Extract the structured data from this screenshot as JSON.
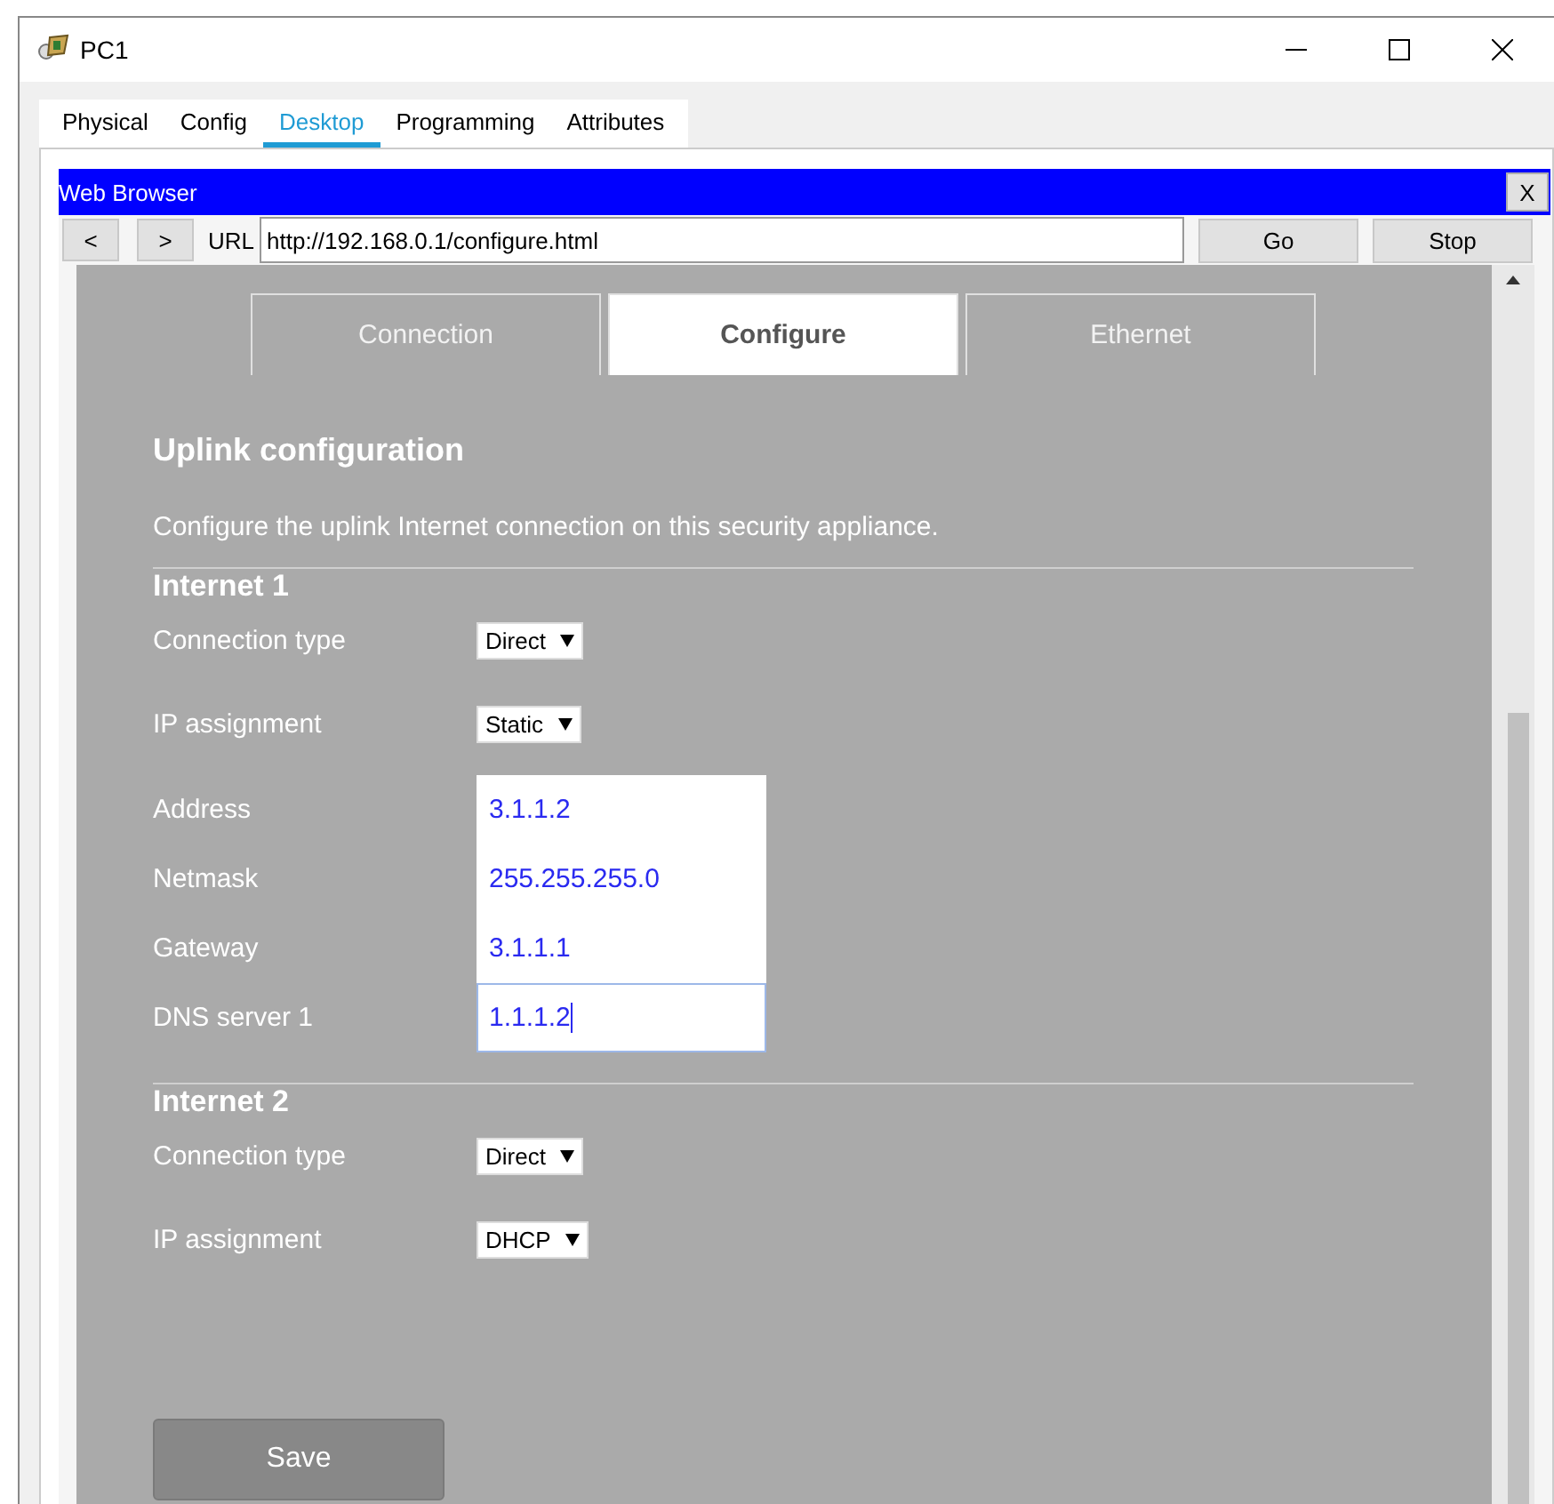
{
  "window": {
    "title": "PC1"
  },
  "tabs": [
    {
      "label": "Physical",
      "selected": false
    },
    {
      "label": "Config",
      "selected": false
    },
    {
      "label": "Desktop",
      "selected": true
    },
    {
      "label": "Programming",
      "selected": false
    },
    {
      "label": "Attributes",
      "selected": false
    }
  ],
  "browser": {
    "title": "Web Browser",
    "close": "X",
    "back": "<",
    "forward": ">",
    "url_label": "URL",
    "url": "http://192.168.0.1/configure.html",
    "go": "Go",
    "stop": "Stop"
  },
  "page": {
    "nav": [
      {
        "label": "Connection",
        "selected": false
      },
      {
        "label": "Configure",
        "selected": true
      },
      {
        "label": "Ethernet",
        "selected": false
      }
    ],
    "heading": "Uplink configuration",
    "intro": "Configure the uplink Internet connection on this security appliance.",
    "sections": [
      {
        "title": "Internet 1",
        "fields": [
          {
            "kind": "select",
            "label": "Connection type",
            "value": "Direct"
          },
          {
            "kind": "select",
            "label": "IP assignment",
            "value": "Static"
          },
          {
            "kind": "text",
            "label": "Address",
            "value": "3.1.1.2",
            "focused": false
          },
          {
            "kind": "text",
            "label": "Netmask",
            "value": "255.255.255.0",
            "focused": false
          },
          {
            "kind": "text",
            "label": "Gateway",
            "value": "3.1.1.1",
            "focused": false
          },
          {
            "kind": "text",
            "label": "DNS server 1",
            "value": "1.1.1.2",
            "focused": true
          }
        ]
      },
      {
        "title": "Internet 2",
        "fields": [
          {
            "kind": "select",
            "label": "Connection type",
            "value": "Direct"
          },
          {
            "kind": "select",
            "label": "IP assignment",
            "value": "DHCP"
          }
        ]
      }
    ],
    "save": "Save"
  }
}
